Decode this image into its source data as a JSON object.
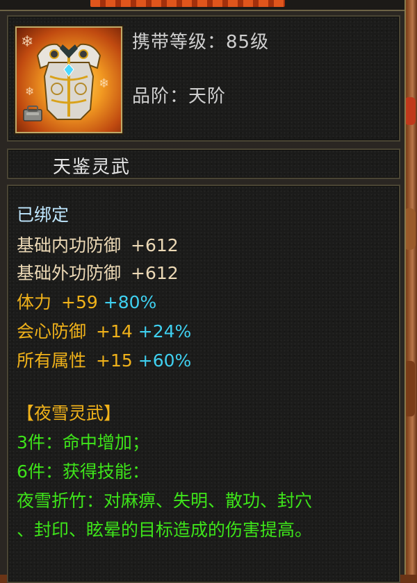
{
  "item": {
    "carry_level_label": "携带等级：",
    "carry_level_value": "85级",
    "grade_label": "品阶：",
    "grade_value": "天阶",
    "name": "天鉴灵武",
    "icon": "armor-chestplate-icon"
  },
  "attributes": {
    "bound": "已绑定",
    "base_internal_def_label": "基础内功防御",
    "base_internal_def_value": "+612",
    "base_external_def_label": "基础外功防御",
    "base_external_def_value": "+612",
    "stamina_label": "体力",
    "stamina_value": "+59",
    "stamina_pct": "+80%",
    "crit_def_label": "会心防御",
    "crit_def_value": "+14",
    "crit_def_pct": "+24%",
    "all_attr_label": "所有属性",
    "all_attr_value": "+15",
    "all_attr_pct": "+60%"
  },
  "set": {
    "title": "【夜雪灵武】",
    "piece3": "3件：命中增加；",
    "piece6": "6件：获得技能：",
    "skill_line1": "夜雪折竹：对麻痹、失明、散功、封穴",
    "skill_line2": "、封印、眩晕的目标造成的伤害提高。"
  },
  "colors": {
    "bound": "#bfe7ff",
    "base": "#ecd9b6",
    "bonus": "#f0b21a",
    "percent": "#3fd0f0",
    "set": "#3ee41a"
  }
}
